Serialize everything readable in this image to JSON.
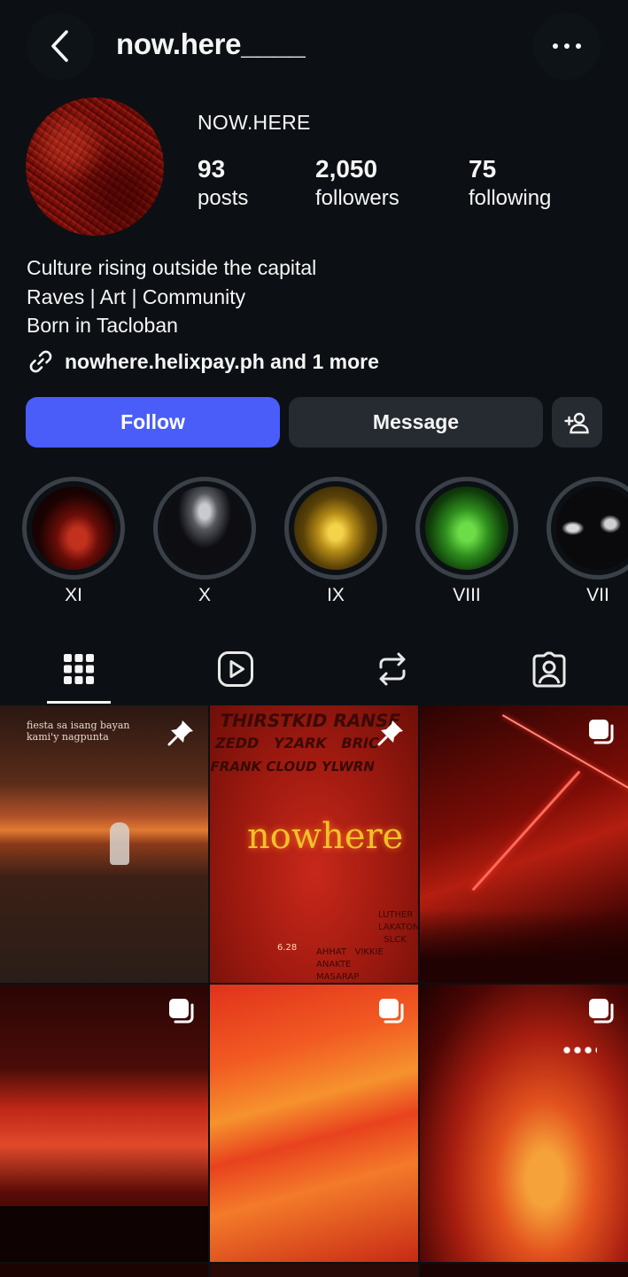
{
  "header": {
    "username": "now.here____",
    "back_icon": "chevron-left-icon",
    "more_icon": "more-horizontal-icon"
  },
  "profile": {
    "display_name": "NOW.HERE",
    "stats": [
      {
        "value": "93",
        "label": "posts"
      },
      {
        "value": "2,050",
        "label": "followers"
      },
      {
        "value": "75",
        "label": "following"
      }
    ],
    "bio": [
      "Culture rising outside the capital",
      "Raves | Art | Community",
      "Born in Tacloban"
    ],
    "link_text": "nowhere.helixpay.ph and 1 more",
    "link_icon": "link-icon"
  },
  "actions": {
    "follow_label": "Follow",
    "message_label": "Message",
    "add_user_icon": "person-add-icon",
    "follow_color": "#4a5df9"
  },
  "highlights": [
    {
      "label": "XI"
    },
    {
      "label": "X"
    },
    {
      "label": "IX"
    },
    {
      "label": "VIII"
    },
    {
      "label": "VII"
    }
  ],
  "tabs": [
    {
      "name": "grid",
      "icon": "grid-icon",
      "active": true
    },
    {
      "name": "reels",
      "icon": "reels-icon",
      "active": false
    },
    {
      "name": "reposts",
      "icon": "repost-icon",
      "active": false
    },
    {
      "name": "tagged",
      "icon": "tagged-icon",
      "active": false
    }
  ],
  "posts": [
    {
      "badge": "pin-icon",
      "caption_lines": [
        "fiesta sa isang bayan",
        "kami'y nagpunta"
      ]
    },
    {
      "badge": "pin-icon",
      "title": "nowhere",
      "names": [
        "THIRSTKID",
        "RANSE",
        "ZEDD",
        "Y2ARK",
        "FRANK CLOUD",
        "BRIC",
        "YLWRN",
        "LUTHER",
        "LAKATON",
        "SLCK",
        "AHHAT",
        "VIKKIE ANAKTE",
        "MASARAP",
        "6.28"
      ]
    },
    {
      "badge": "carousel-icon"
    },
    {
      "badge": "carousel-icon"
    },
    {
      "badge": "carousel-icon"
    },
    {
      "badge": "carousel-icon"
    }
  ]
}
